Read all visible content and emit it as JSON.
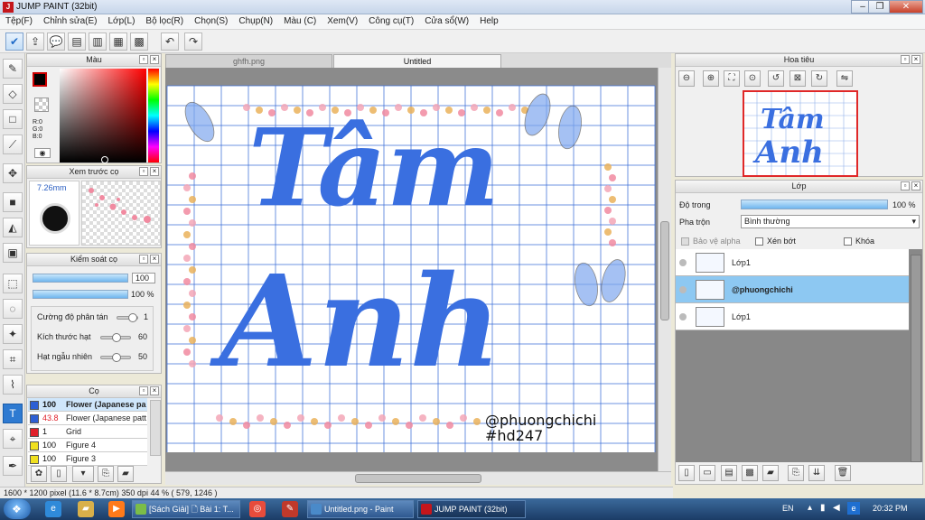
{
  "window": {
    "title": "JUMP PAINT (32bit)",
    "logo": "J"
  },
  "menu": [
    "Tệp(F)",
    "Chỉnh sửa(E)",
    "Lớp(L)",
    "Bộ lọc(R)",
    "Chọn(S)",
    "Chụp(N)",
    "Màu (C)",
    "Xem(V)",
    "Công cụ(T)",
    "Cửa sổ(W)",
    "Help"
  ],
  "color_panel": {
    "title": "Màu",
    "r": "R:0",
    "g": "G:0",
    "b": "B:0",
    "fg_color": "#000000",
    "bg_color": "#ffffff"
  },
  "brush_preview": {
    "title": "Xem trước cọ",
    "size": "7.26mm"
  },
  "brush_control": {
    "title": "Kiểm soát cọ",
    "size_value": "100",
    "opacity_value": "100 %",
    "scatter_label": "Cường độ phân tán",
    "scatter_value": "1",
    "particle_label": "Kích thước hạt",
    "particle_value": "60",
    "random_label": "Hạt ngẫu nhiên",
    "random_value": "50"
  },
  "brush_list": {
    "title": "Cọ",
    "items": [
      {
        "value": "100",
        "name": "Flower (Japanese pa",
        "color": "#2d5fd4",
        "selected": true
      },
      {
        "value": "43.8",
        "name": "Flower (Japanese patt",
        "color": "#2d5fd4",
        "selected": false
      },
      {
        "value": "1",
        "name": "Grid",
        "color": "#e0202a",
        "selected": false
      },
      {
        "value": "100",
        "name": "Figure 4",
        "color": "#f0e020",
        "selected": false
      },
      {
        "value": "100",
        "name": "Figure 3",
        "color": "#f0e020",
        "selected": false
      }
    ]
  },
  "tabs": [
    {
      "label": "ghfh.png",
      "active": false
    },
    {
      "label": "Untitled",
      "active": true
    }
  ],
  "canvas": {
    "watermark_line1": "@phuongchichi",
    "watermark_line2": "#hd247",
    "art_line1": "Tâm",
    "art_line2": "Anh",
    "main_color": "#3a6fe0",
    "grid_color": "#3c6fd8"
  },
  "navigator": {
    "title": "Hoa tiêu"
  },
  "layer_panel": {
    "title": "Lớp",
    "opacity_label": "Độ trong",
    "opacity_value": "100 %",
    "blend_label": "Pha trộn",
    "blend_value": "Bình thường",
    "protect_alpha": "Bảo vệ alpha",
    "clip": "Xén bớt",
    "lock": "Khóa",
    "layers": [
      {
        "name": "Lớp1",
        "selected": false
      },
      {
        "name": "@phuongchichi",
        "selected": true
      },
      {
        "name": "Lớp1",
        "selected": false
      }
    ]
  },
  "status": {
    "text": "1600 * 1200 pixel  (11.6 * 8.7cm)  350 dpi  44 %  ( 579, 1246 )"
  },
  "taskbar": {
    "items": [
      "[Sách Giải] 🗋 Bài 1: T...",
      "Untitled.png - Paint",
      "JUMP PAINT (32bit)"
    ],
    "lang": "EN",
    "time": "20:32 PM"
  }
}
